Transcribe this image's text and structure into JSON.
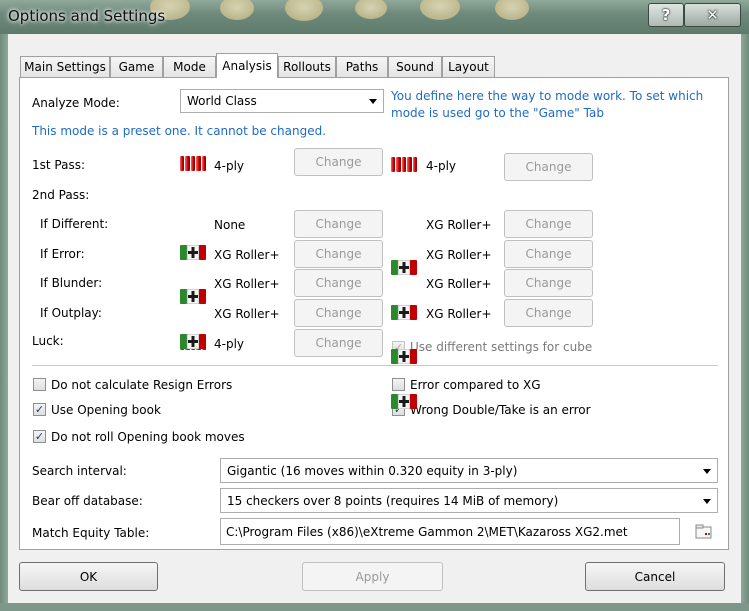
{
  "window": {
    "title": "Options and Settings",
    "help_glyph": "?",
    "close_glyph": "✕"
  },
  "tabs": [
    "Main Settings",
    "Game",
    "Mode",
    "Analysis",
    "Rollouts",
    "Paths",
    "Sound",
    "Layout"
  ],
  "analyze_mode": {
    "label": "Analyze Mode:",
    "value": "World Class",
    "help": "You define here the way to mode work. To set which mode is used go to the \"Game\" Tab",
    "preset_note": "This mode is a preset one. It cannot be changed."
  },
  "rows": [
    {
      "label": "1st Pass:",
      "left_icon": "red-checker-stack-icon",
      "left_value": "4-ply",
      "right_icon": "red-checker-stack-icon",
      "right_value": "4-ply"
    },
    {
      "label": "2nd Pass:"
    },
    {
      "label": "If Different:",
      "left_icon": "",
      "left_value": "None",
      "right_icon": "roller-plus-icon",
      "right_value": "XG Roller+"
    },
    {
      "label": "If Error:",
      "left_icon": "roller-plus-icon",
      "left_value": "XG Roller+",
      "right_icon": "roller-plus-icon",
      "right_value": "XG Roller+"
    },
    {
      "label": "If Blunder:",
      "left_icon": "roller-plus-icon",
      "left_value": "XG Roller+",
      "right_icon": "roller-plus-icon",
      "right_value": "XG Roller+"
    },
    {
      "label": "If Outplay:",
      "left_icon": "roller-plus-icon",
      "left_value": "XG Roller+",
      "right_icon": "roller-plus-icon",
      "right_value": "XG Roller+"
    },
    {
      "label": "Luck:",
      "left_icon": "red-checker-stack-icon",
      "left_value": "4-ply"
    }
  ],
  "change_label": "Change",
  "cube_checkbox": {
    "label": "Use different settings for cube",
    "checked": true
  },
  "options": {
    "no_resign_errors": {
      "label": "Do not calculate Resign Errors",
      "checked": false
    },
    "error_vs_xg": {
      "label": "Error compared to XG",
      "checked": false
    },
    "opening_book": {
      "label": "Use Opening book",
      "checked": true
    },
    "wrong_double": {
      "label": "Wrong Double/Take is an error",
      "checked": true
    },
    "no_roll_book": {
      "label": "Do not roll Opening book moves",
      "checked": true
    }
  },
  "search_interval": {
    "label": "Search interval:",
    "value": "Gigantic (16 moves within 0.320 equity in 3-ply)"
  },
  "bear_off": {
    "label": "Bear off database:",
    "value": "15 checkers over 8 points (requires 14 MiB of memory)"
  },
  "met": {
    "label": "Match Equity Table:",
    "value": "C:\\Program Files (x86)\\eXtreme Gammon 2\\MET\\Kazaross XG2.met"
  },
  "buttons": {
    "ok": "OK",
    "apply": "Apply",
    "cancel": "Cancel"
  },
  "colors": {
    "link_blue": "#1f6bc2",
    "checker_red": "#c00000",
    "roller_green": "#2a8a2a"
  }
}
